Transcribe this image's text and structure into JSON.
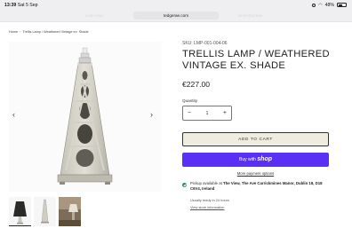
{
  "status_bar": {
    "time": "13:39",
    "date": "Sat 5 Sep",
    "battery": "48%",
    "battery_fraction": 0.48
  },
  "browser": {
    "url": "tedgerae.com",
    "ghost_menu": [
      "LIGHTING",
      "FURNITURE",
      "HOME DECOR",
      "INSPIRATION",
      "COMPANY"
    ]
  },
  "breadcrumb": {
    "home": "Home",
    "current": "Trellis Lamp / Weathered Vintage ex. Shade"
  },
  "product": {
    "sku": "SKU: LMP-001-004-06",
    "title": "TRELLIS LAMP / WEATHERED VINTAGE EX. SHADE",
    "price": "€227.00",
    "quantity_label": "Quantity",
    "quantity_value": "1",
    "minus": "−",
    "plus": "+",
    "add_to_cart": "ADD TO CART",
    "buy_with": "Buy with",
    "shop_brand": "shop",
    "more_payment": "More payment options"
  },
  "pickup": {
    "prefix": "Pickup available at",
    "location": "The View, The Ave Carrickmines Manor, Dublin 18, D18 C6V4, Ireland",
    "ready": "Usually ready in 24 hours",
    "store_info": "View store information"
  },
  "gallery": {
    "prev": "‹",
    "next": "›",
    "thumb_count": 3
  }
}
